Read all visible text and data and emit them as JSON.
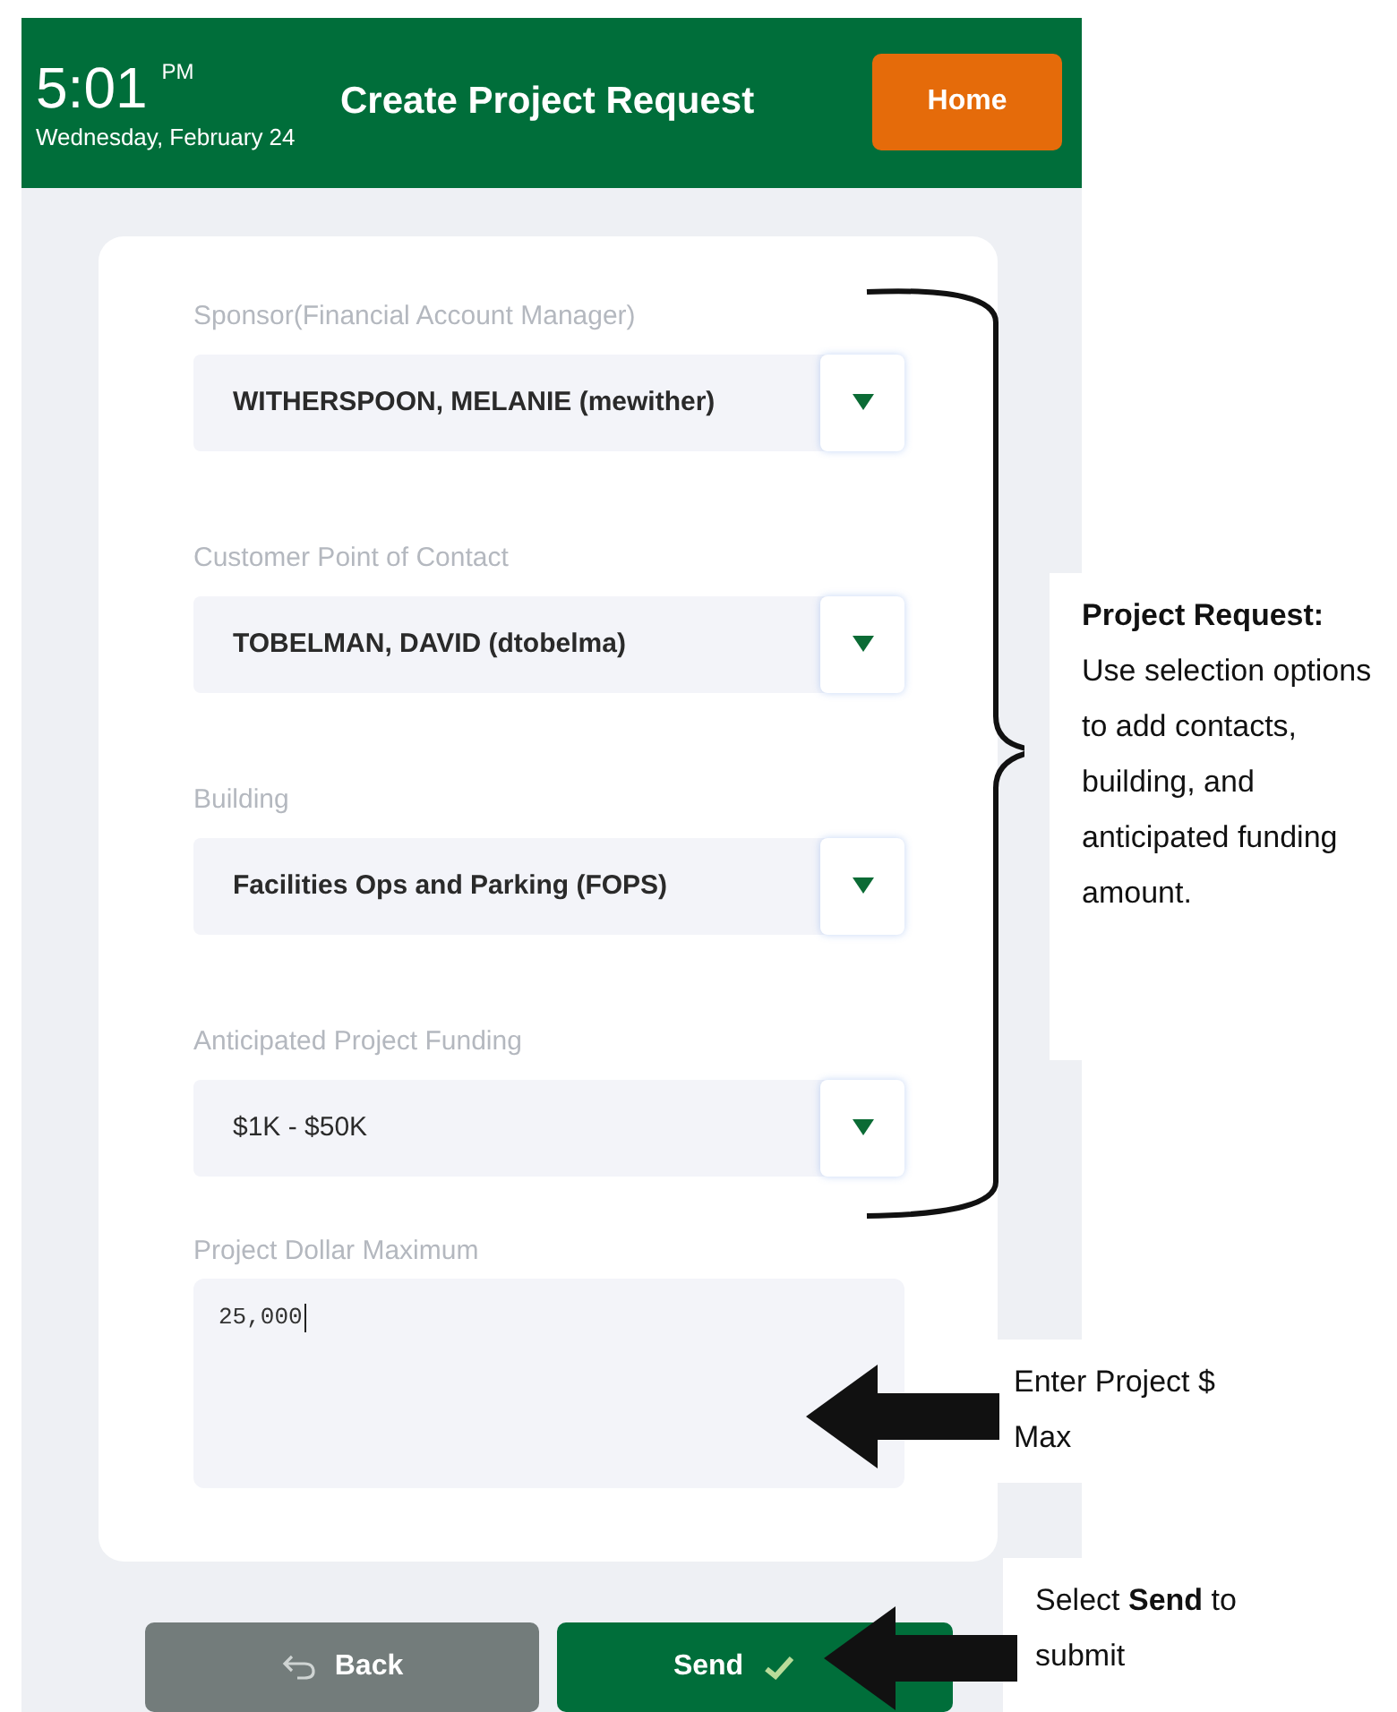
{
  "header": {
    "time": "5:01",
    "meridiem": "PM",
    "date": "Wednesday, February 24",
    "title": "Create Project Request",
    "home_button": "Home"
  },
  "fields": [
    {
      "kind": "select",
      "label": "Sponsor(Financial Account Manager)",
      "value": "WITHERSPOON, MELANIE (mewither)"
    },
    {
      "kind": "select",
      "label": "Customer Point of Contact",
      "value": "TOBELMAN, DAVID (dtobelma)"
    },
    {
      "kind": "select",
      "label": "Building",
      "value": "Facilities Ops and Parking (FOPS)"
    },
    {
      "kind": "select",
      "label": "Anticipated Project Funding",
      "value": "$1K - $50K"
    },
    {
      "kind": "text",
      "label": "Project Dollar Maximum",
      "value": "25,000"
    }
  ],
  "buttons": {
    "back": "Back",
    "send": "Send"
  },
  "annotations": [
    {
      "kind": "brace",
      "text": "**Project Request:** Use selection options to add contacts, building, and anticipated funding amount."
    },
    {
      "kind": "arrow",
      "text": "Enter Project $ Max"
    },
    {
      "kind": "arrow",
      "text": "Select **Send** to submit"
    }
  ]
}
